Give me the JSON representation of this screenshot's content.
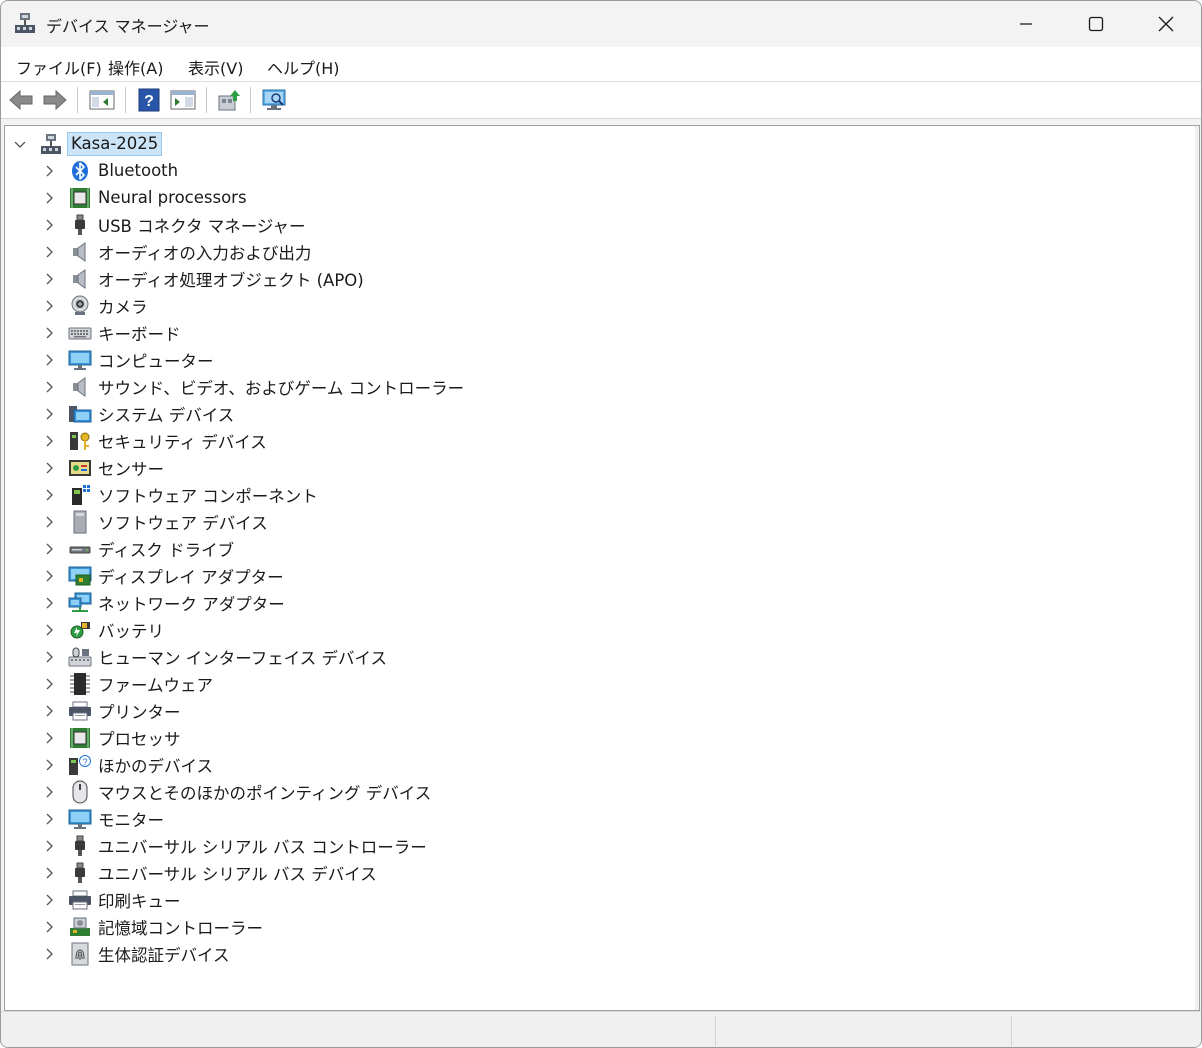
{
  "window": {
    "title": "デバイス マネージャー"
  },
  "menubar": {
    "items": [
      {
        "label": "ファイル(F)"
      },
      {
        "label": "操作(A)"
      },
      {
        "label": "表示(V)"
      },
      {
        "label": "ヘルプ(H)"
      }
    ]
  },
  "toolbar": {
    "buttons": [
      "back-icon",
      "forward-icon",
      "show-hide-console-tree-icon",
      "help-icon",
      "properties-pane-icon",
      "update-driver-icon",
      "scan-hardware-icon"
    ]
  },
  "tree": {
    "root": {
      "label": "Kasa-2025",
      "icon": "computer-network-icon"
    },
    "items": [
      {
        "label": "Bluetooth",
        "icon": "bluetooth-icon"
      },
      {
        "label": "Neural processors",
        "icon": "processor-icon"
      },
      {
        "label": "USB コネクタ マネージャー",
        "icon": "usb-plug-icon"
      },
      {
        "label": "オーディオの入力および出力",
        "icon": "speaker-icon"
      },
      {
        "label": "オーディオ処理オブジェクト (APO)",
        "icon": "speaker-icon"
      },
      {
        "label": "カメラ",
        "icon": "webcam-icon"
      },
      {
        "label": "キーボード",
        "icon": "keyboard-icon"
      },
      {
        "label": "コンピューター",
        "icon": "monitor-icon"
      },
      {
        "label": "サウンド、ビデオ、およびゲーム コントローラー",
        "icon": "speaker-icon"
      },
      {
        "label": "システム デバイス",
        "icon": "system-folder-icon"
      },
      {
        "label": "セキュリティ デバイス",
        "icon": "security-key-icon"
      },
      {
        "label": "センサー",
        "icon": "sensor-icon"
      },
      {
        "label": "ソフトウェア コンポーネント",
        "icon": "software-component-icon"
      },
      {
        "label": "ソフトウェア デバイス",
        "icon": "software-device-icon"
      },
      {
        "label": "ディスク ドライブ",
        "icon": "disk-drive-icon"
      },
      {
        "label": "ディスプレイ アダプター",
        "icon": "display-adapter-icon"
      },
      {
        "label": "ネットワーク アダプター",
        "icon": "network-adapter-icon"
      },
      {
        "label": "バッテリ",
        "icon": "battery-icon"
      },
      {
        "label": "ヒューマン インターフェイス デバイス",
        "icon": "hid-icon"
      },
      {
        "label": "ファームウェア",
        "icon": "firmware-chip-icon"
      },
      {
        "label": "プリンター",
        "icon": "printer-icon"
      },
      {
        "label": "プロセッサ",
        "icon": "processor-icon"
      },
      {
        "label": "ほかのデバイス",
        "icon": "unknown-device-icon"
      },
      {
        "label": "マウスとそのほかのポインティング デバイス",
        "icon": "mouse-icon"
      },
      {
        "label": "モニター",
        "icon": "monitor-icon"
      },
      {
        "label": "ユニバーサル シリアル バス コントローラー",
        "icon": "usb-plug-icon"
      },
      {
        "label": "ユニバーサル シリアル バス デバイス",
        "icon": "usb-plug-icon"
      },
      {
        "label": "印刷キュー",
        "icon": "printer-icon"
      },
      {
        "label": "記憶域コントローラー",
        "icon": "storage-controller-icon"
      },
      {
        "label": "生体認証デバイス",
        "icon": "fingerprint-icon"
      }
    ]
  }
}
